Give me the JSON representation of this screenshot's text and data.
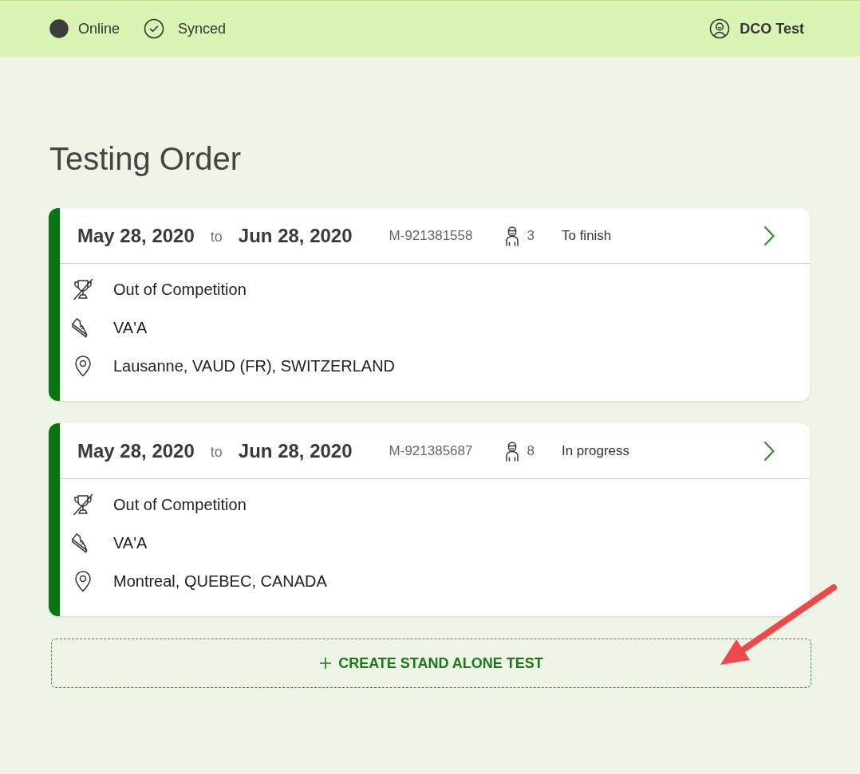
{
  "header": {
    "connection": {
      "label": "Online",
      "online": true
    },
    "sync": {
      "label": "Synced"
    },
    "user": {
      "name": "DCO Test"
    }
  },
  "page": {
    "title": "Testing Order"
  },
  "orders": [
    {
      "start_date": "May 28, 2020",
      "separator": "to",
      "end_date": "Jun 28, 2020",
      "order_id": "M-921381558",
      "athlete_count": "3",
      "status": "To finish",
      "details": [
        {
          "kind": "competition",
          "text": "Out of Competition"
        },
        {
          "kind": "sport",
          "text": "VA'A"
        },
        {
          "kind": "location",
          "text": "Lausanne, VAUD (FR), SWITZERLAND"
        }
      ]
    },
    {
      "start_date": "May 28, 2020",
      "separator": "to",
      "end_date": "Jun 28, 2020",
      "order_id": "M-921385687",
      "athlete_count": "8",
      "status": "In progress",
      "details": [
        {
          "kind": "competition",
          "text": "Out of Competition"
        },
        {
          "kind": "sport",
          "text": "VA'A"
        },
        {
          "kind": "location",
          "text": "Montreal, QUEBEC, CANADA"
        }
      ]
    }
  ],
  "create_button": {
    "label": "CREATE STAND ALONE TEST"
  }
}
